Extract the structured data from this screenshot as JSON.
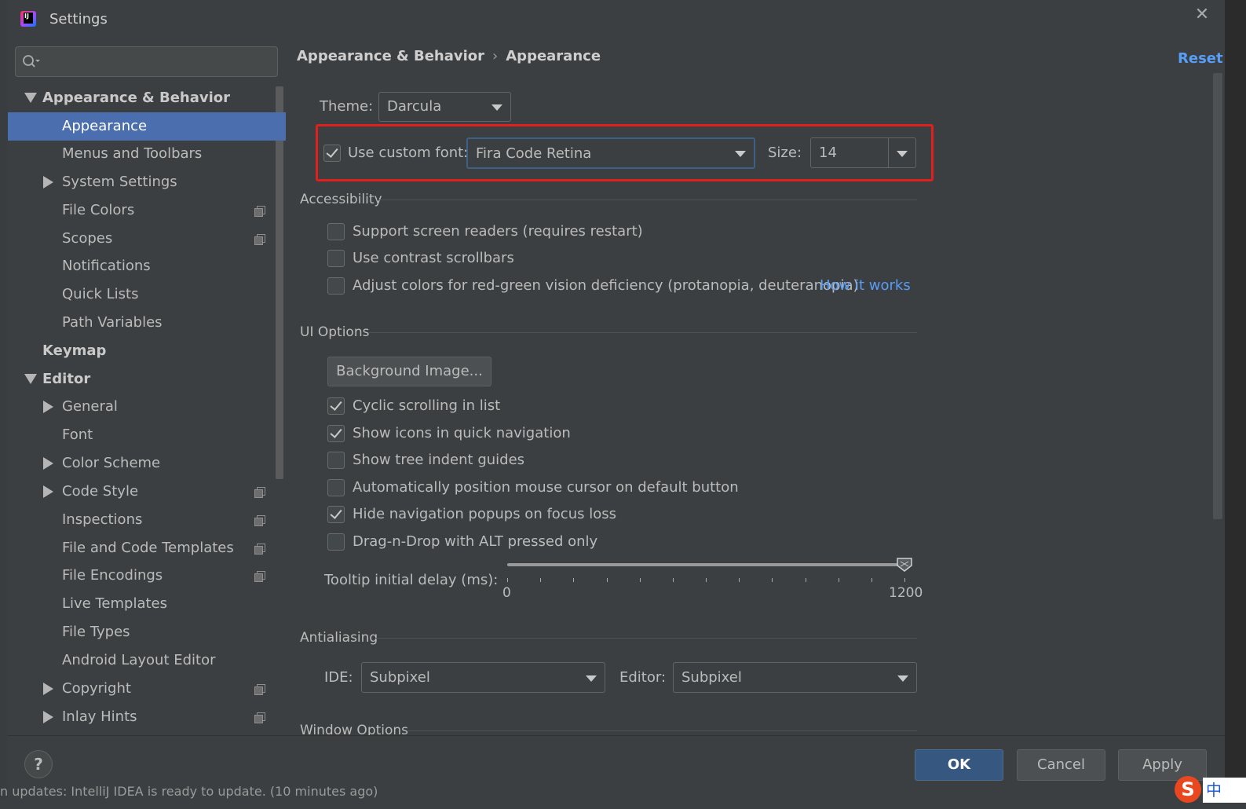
{
  "window": {
    "title": "Settings",
    "app_logo_letters": "IJ"
  },
  "search": {
    "placeholder": ""
  },
  "sidebar": {
    "items": [
      {
        "label": "Appearance & Behavior",
        "expanded": true
      },
      {
        "label": "Appearance",
        "selected": true
      },
      {
        "label": "Menus and Toolbars"
      },
      {
        "label": "System Settings"
      },
      {
        "label": "File Colors"
      },
      {
        "label": "Scopes"
      },
      {
        "label": "Notifications"
      },
      {
        "label": "Quick Lists"
      },
      {
        "label": "Path Variables"
      },
      {
        "label": "Keymap"
      },
      {
        "label": "Editor",
        "expanded": true
      },
      {
        "label": "General"
      },
      {
        "label": "Font"
      },
      {
        "label": "Color Scheme"
      },
      {
        "label": "Code Style"
      },
      {
        "label": "Inspections"
      },
      {
        "label": "File and Code Templates"
      },
      {
        "label": "File Encodings"
      },
      {
        "label": "Live Templates"
      },
      {
        "label": "File Types"
      },
      {
        "label": "Android Layout Editor"
      },
      {
        "label": "Copyright"
      },
      {
        "label": "Inlay Hints"
      }
    ]
  },
  "breadcrumb": {
    "parent": "Appearance & Behavior",
    "separator": "›",
    "current": "Appearance"
  },
  "reset_label": "Reset",
  "theme": {
    "label": "Theme:",
    "value": "Darcula"
  },
  "custom_font": {
    "label": "Use custom font:",
    "checked": true,
    "value": "Fira Code Retina",
    "size_label": "Size:",
    "size_value": "14"
  },
  "accessibility": {
    "title": "Accessibility",
    "options": [
      {
        "label": "Support screen readers (requires restart)",
        "checked": false
      },
      {
        "label": "Use contrast scrollbars",
        "checked": false
      },
      {
        "label": "Adjust colors for red-green vision deficiency (protanopia, deuteranopia)",
        "checked": false
      }
    ],
    "link": "How it works"
  },
  "ui_options": {
    "title": "UI Options",
    "background_button": "Background Image...",
    "options": [
      {
        "label": "Cyclic scrolling in list",
        "checked": true
      },
      {
        "label": "Show icons in quick navigation",
        "checked": true
      },
      {
        "label": "Show tree indent guides",
        "checked": false
      },
      {
        "label": "Automatically position mouse cursor on default button",
        "checked": false
      },
      {
        "label": "Hide navigation popups on focus loss",
        "checked": true
      },
      {
        "label": "Drag-n-Drop with ALT pressed only",
        "checked": false
      }
    ],
    "tooltip_delay": {
      "label": "Tooltip initial delay (ms):",
      "min": "0",
      "max": "1200",
      "value": 1200
    }
  },
  "antialiasing": {
    "title": "Antialiasing",
    "ide_label": "IDE:",
    "ide_value": "Subpixel",
    "editor_label": "Editor:",
    "editor_value": "Subpixel"
  },
  "window_options": {
    "title": "Window Options"
  },
  "footer": {
    "help": "?",
    "ok": "OK",
    "cancel": "Cancel",
    "apply": "Apply"
  },
  "status_bar": {
    "text": "n updates: IntelliJ IDEA is ready to update. (10 minutes ago)"
  },
  "ime": {
    "logo": "S",
    "text": "中"
  },
  "colors": {
    "selection": "#4b6eaf",
    "link": "#589df6",
    "highlight": "#e0201c",
    "ok_button": "#365880"
  }
}
